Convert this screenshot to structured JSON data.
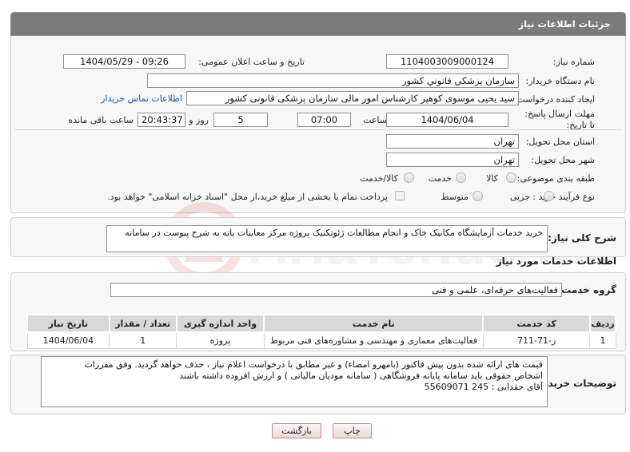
{
  "title": "جزئیات اطلاعات نیاز",
  "fields": {
    "need_number_label": "شماره نیاز:",
    "need_number": "1104003009000124",
    "announce_label": "تاریخ و ساعت اعلان عمومی:",
    "announce_value": "1404/05/29 - 09:26",
    "buyer_org_label": "نام دستگاه خریدار:",
    "buyer_org": "سازمان پزشكي قانوني كشور",
    "creator_label": "ایجاد کننده درخواست:",
    "creator": "سید یحیی موسوی کوهپر کارشناس امور مالی سازمان پزشکی قانونی کشور",
    "contact_link": "اطلاعات تماس خریدار",
    "deadline_label": "مهلت ارسال پاسخ: تا تاریخ:",
    "deadline_date": "1404/06/04",
    "time_label": "ساعت",
    "deadline_time": "07:00",
    "days_value": "5",
    "days_label": "روز و",
    "remaining_time": "20:43:37",
    "remaining_label": "ساعت باقی مانده",
    "province_label": "استان محل تحویل:",
    "province": "تهران",
    "city_label": "شهر محل تحویل:",
    "city": "تهران",
    "category_label": "طبقه بندی موضوعی:",
    "category_options": [
      "کالا",
      "خدمت",
      "کالا/خدمت"
    ],
    "process_label": "نوع فرآیند خرید :",
    "process_options": [
      "جزیی",
      "متوسط"
    ],
    "payment_note": "پرداخت تمام یا بخشی از مبلغ خرید،از محل \"اسناد خزانه اسلامی\" خواهد بود."
  },
  "summary": {
    "label": "شرح کلی نیاز:",
    "text": "خرید خدمات آزمایشگاه مکانیک خاک و انجام مطالعات ژئوتکنیک پروژه مرکز معاینات باته  به شرح پیوست در سامانه"
  },
  "services": {
    "section_title": "اطلاعات خدمات مورد نیاز",
    "group_label": "گروه خدمت:",
    "group_value": "فعالیت‌های حرفه‌ای، علمی و فنی",
    "headers": [
      "ردیف",
      "کد خدمت",
      "نام خدمت",
      "واحد اندازه گیری",
      "تعداد / مقدار",
      "تاریخ نیاز"
    ],
    "rows": [
      [
        "1",
        "ز-71-711",
        "فعالیت‌های معماری و مهندسی و مشاوره‌های فنی مربوط",
        "پروژه",
        "1",
        "1404/06/04"
      ]
    ]
  },
  "buyer_notes": {
    "label": "توضیحات خریدار:",
    "line1": "قیمت های ارائه شده بدون پیش فاکتور (بامهرو امضاء) و غیر مطابق با درخواست اعلام نیاز  ، حذف خواهد گردید. وفق مقررات",
    "line2": "اشخاص حقوقی باید سامانه پایانه فروشگاهی ( سامانه مودیان مالیاتی ) و ارزش افزوده  داشته باشند",
    "line3": "آقای حقدایی  :  245       55609071"
  },
  "buttons": {
    "print": "چاپ",
    "back": "بازگشت"
  },
  "watermark_text": "AriaTender.neT"
}
